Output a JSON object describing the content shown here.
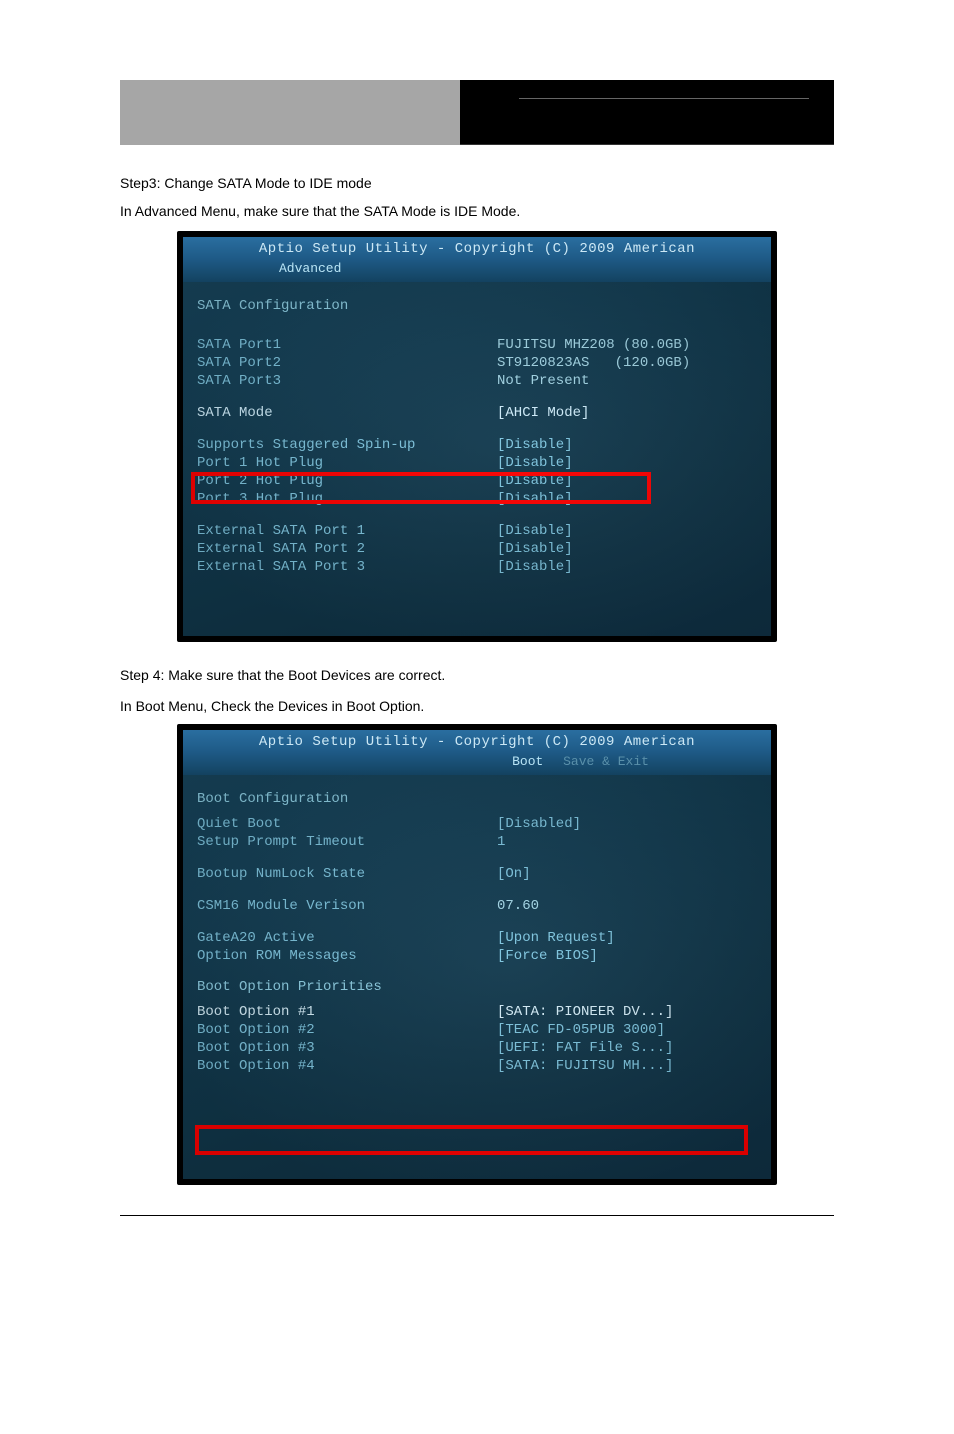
{
  "doc": {
    "step3_intro": "Step3: Change SATA Mode to IDE mode",
    "advanced_menu_note": "In Advanced Menu, make sure that the SATA Mode is IDE Mode.",
    "step4_intro": "Step 4: Make sure that the Boot Devices are correct.",
    "boot_menu_note": "In Boot Menu, Check the Devices in Boot Option."
  },
  "bios1": {
    "titlebar": "Aptio Setup Utility - Copyright (C) 2009 American",
    "tab_active": "Advanced",
    "heading": "SATA Configuration",
    "rows_ports": [
      {
        "label": "SATA Port1",
        "value": "FUJITSU MHZ208 (80.0GB)"
      },
      {
        "label": "SATA Port2",
        "value": "ST9120823AS   (120.0GB)"
      },
      {
        "label": "SATA Port3",
        "value": "Not Present"
      }
    ],
    "sata_mode_label": "SATA Mode",
    "sata_mode_value": "[AHCI Mode]",
    "rows_spin": [
      {
        "label": "Supports Staggered Spin-up",
        "value": "[Disable]"
      },
      {
        "label": "Port 1 Hot Plug",
        "value": "[Disable]"
      },
      {
        "label": "Port 2 Hot Plug",
        "value": "[Disable]"
      },
      {
        "label": "Port 3 Hot Plug",
        "value": "[Disable]"
      }
    ],
    "rows_ext": [
      {
        "label": "External SATA Port 1",
        "value": "[Disable]"
      },
      {
        "label": "External SATA Port 2",
        "value": "[Disable]"
      },
      {
        "label": "External SATA Port 3",
        "value": "[Disable]"
      }
    ]
  },
  "bios2": {
    "titlebar": "Aptio Setup Utility - Copyright (C) 2009 American",
    "tab_active": "Boot",
    "tab_right": "Save & Exit",
    "heading": "Boot Configuration",
    "rows_cfg": [
      {
        "label": "Quiet Boot",
        "value": "[Disabled]"
      },
      {
        "label": "Setup Prompt Timeout",
        "value": "1"
      }
    ],
    "numlock": {
      "label": "Bootup NumLock State",
      "value": "[On]"
    },
    "csm": {
      "label": "CSM16 Module Verison",
      "value": "07.60"
    },
    "gate": {
      "label": "GateA20 Active",
      "value": "[Upon Request]"
    },
    "oprom": {
      "label": "Option ROM Messages",
      "value": "[Force BIOS]"
    },
    "boot_prio_heading": "Boot Option Priorities",
    "boot_opts": [
      {
        "label": "Boot Option #1",
        "value": "[SATA: PIONEER DV...]"
      },
      {
        "label": "Boot Option #2",
        "value": "[TEAC FD-05PUB 3000]"
      },
      {
        "label": "Boot Option #3",
        "value": "[UEFI: FAT File S...]"
      },
      {
        "label": "Boot Option #4",
        "value": "[SATA: FUJITSU MH...]"
      }
    ]
  }
}
